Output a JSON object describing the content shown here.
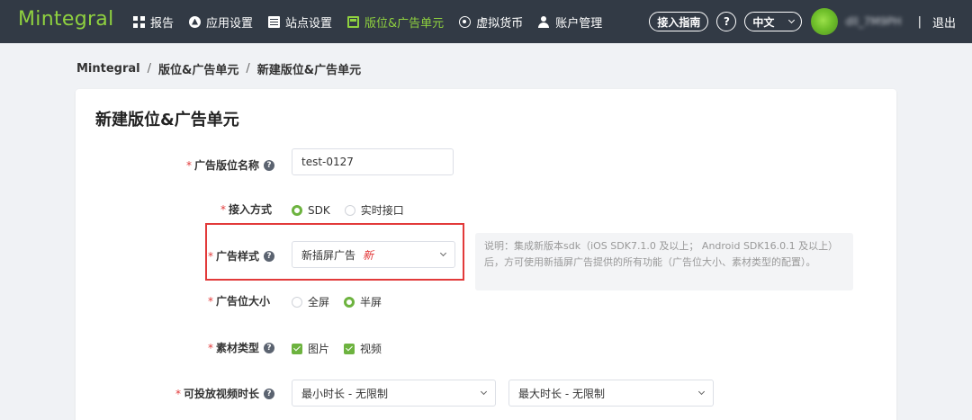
{
  "app": {
    "logo": "Mintegral"
  },
  "nav": {
    "items": [
      {
        "label": "报告",
        "icon": "dashboard-icon"
      },
      {
        "label": "应用设置",
        "icon": "app-icon"
      },
      {
        "label": "站点设置",
        "icon": "list-icon"
      },
      {
        "label": "版位&广告单元",
        "icon": "placement-icon",
        "active": true
      },
      {
        "label": "虚拟货币",
        "icon": "coin-icon"
      },
      {
        "label": "账户管理",
        "icon": "user-icon"
      }
    ],
    "guide_label": "接入指南",
    "help_label": "?",
    "lang_label": "中文",
    "username": "dll_7M9PH",
    "separator": "|",
    "logout_label": "退出"
  },
  "breadcrumb": [
    "Mintegral",
    "版位&广告单元",
    "新建版位&广告单元"
  ],
  "breadcrumb_sep": "/",
  "page_title": "新建版位&广告单元",
  "form": {
    "required_mark": "*",
    "help_glyph": "?",
    "placement_name": {
      "label": "广告版位名称",
      "value": "test-0127"
    },
    "access_method": {
      "label": "接入方式",
      "options": [
        "SDK",
        "实时接口"
      ],
      "selected": "SDK"
    },
    "ad_style": {
      "label": "广告样式",
      "value": "新插屏广告",
      "tag": "新"
    },
    "ad_style_note": "说明：集成新版本sdk（iOS SDK7.1.0 及以上； Android SDK16.0.1 及以上）后，方可使用新插屏广告提供的所有功能（广告位大小、素材类型的配置）。",
    "ad_size": {
      "label": "广告位大小",
      "options": [
        "全屏",
        "半屏"
      ],
      "selected": "半屏"
    },
    "material_type": {
      "label": "素材类型",
      "options": [
        "图片",
        "视频"
      ]
    },
    "video_duration": {
      "label": "可投放视频时长",
      "min_value": "最小时长 - 无限制",
      "max_value": "最大时长 - 无限制"
    }
  },
  "colors": {
    "nav_bg": "#323a45",
    "accent": "#8fd13f",
    "required": "#e23a3a",
    "highlight_box": "#e23a3a"
  }
}
